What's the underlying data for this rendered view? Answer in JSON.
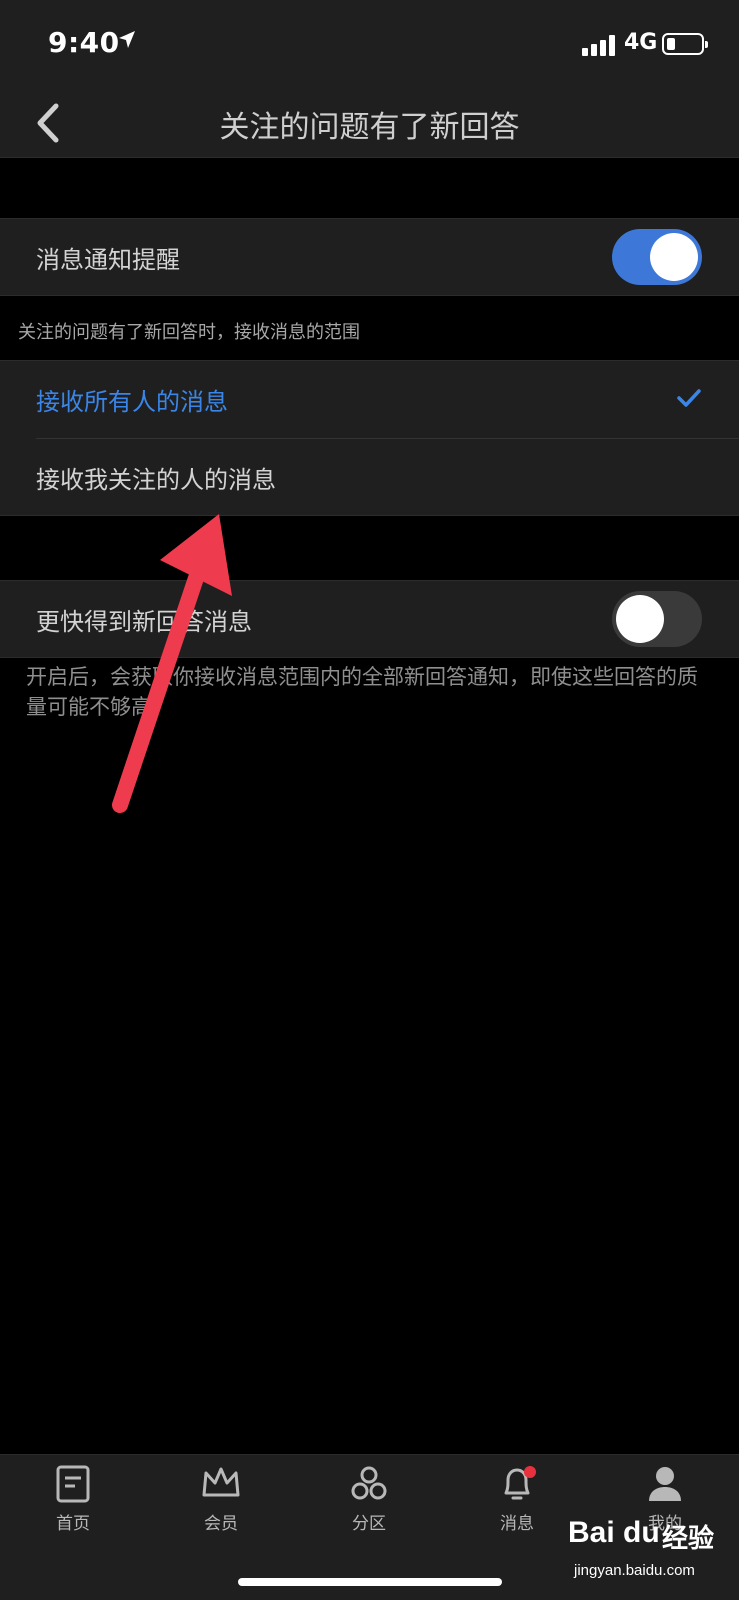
{
  "status_bar": {
    "time": "9:40",
    "network": "4G",
    "battery_fraction": 0.25
  },
  "nav": {
    "title": "关注的问题有了新回答"
  },
  "notify_row": {
    "label": "消息通知提醒",
    "enabled": true
  },
  "scope": {
    "caption": "关注的问题有了新回答时，接收消息的范围",
    "options": [
      {
        "label": "接收所有人的消息",
        "selected": true
      },
      {
        "label": "接收我关注的人的消息",
        "selected": false
      }
    ]
  },
  "faster_row": {
    "label": "更快得到新回答消息",
    "enabled": false
  },
  "faster_description": "开启后，会获取你接收消息范围内的全部新回答通知，即使这些回答的质量可能不够高",
  "tab_bar": {
    "tabs": [
      {
        "label": "首页",
        "icon": "document-icon"
      },
      {
        "label": "会员",
        "icon": "crown-icon"
      },
      {
        "label": "分区",
        "icon": "hexagons-icon"
      },
      {
        "label": "消息",
        "icon": "bell-icon",
        "has_badge": true
      },
      {
        "label": "我的",
        "icon": "person-icon"
      }
    ]
  },
  "watermark": {
    "brand": "Bai du",
    "sub": "经验",
    "url": "jingyan.baidu.com"
  },
  "colors": {
    "accent": "#3a86e8",
    "toggle_on": "#3d78d8",
    "arrow": "#ee3c4e",
    "background": "#000000",
    "surface": "#1f1f1f"
  }
}
